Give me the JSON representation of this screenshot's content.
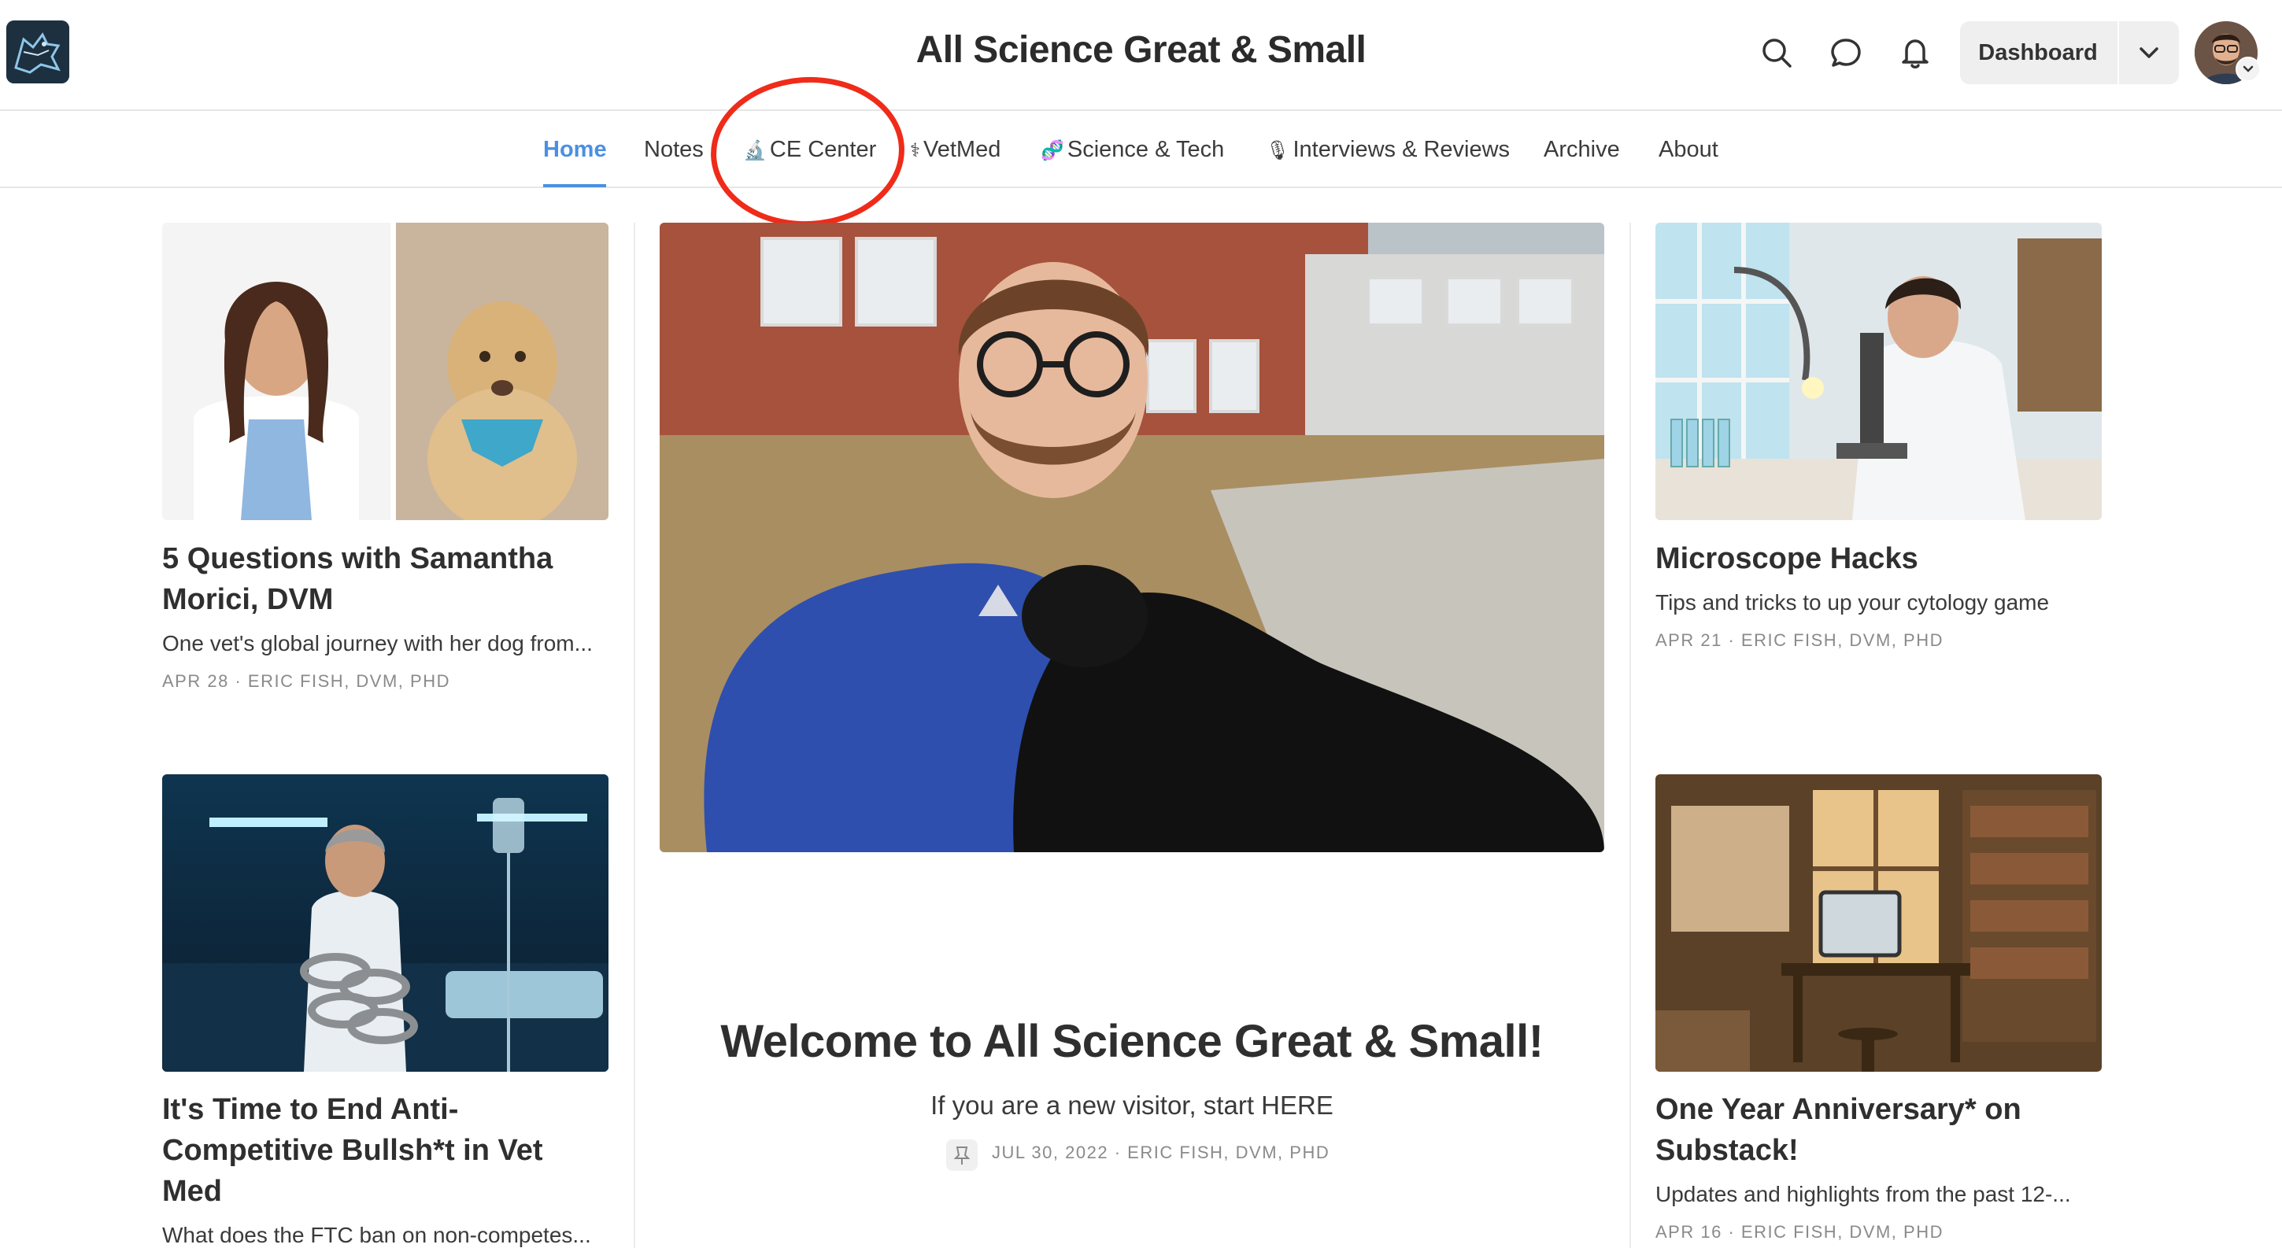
{
  "site": {
    "title": "All Science Great & Small"
  },
  "header": {
    "dashboard_label": "Dashboard"
  },
  "nav": [
    {
      "label": "Home",
      "icon": "",
      "active": true
    },
    {
      "label": "Notes",
      "icon": ""
    },
    {
      "label": "CE Center",
      "icon": "🔬"
    },
    {
      "label": "VetMed",
      "icon": "⚕"
    },
    {
      "label": "Science & Tech",
      "icon": "🧬"
    },
    {
      "label": "Interviews & Reviews",
      "icon": "🎙"
    },
    {
      "label": "Archive",
      "icon": ""
    },
    {
      "label": "About",
      "icon": ""
    }
  ],
  "annotation": {
    "color": "#ef2b1a"
  },
  "posts": [
    {
      "title": "5 Questions with Samantha Morici, DVM",
      "subtitle": "One vet's global journey with her dog from...",
      "date": "APR 28",
      "author": "ERIC FISH, DVM, PHD"
    },
    {
      "title": "It's Time to End Anti-Competitive Bullsh*t in Vet Med",
      "subtitle": "What does the FTC ban on non-competes...",
      "date": "",
      "author": ""
    },
    {
      "title": "Microscope Hacks",
      "subtitle": "Tips and tricks to up your cytology game",
      "date": "APR 21",
      "author": "ERIC FISH, DVM, PHD"
    },
    {
      "title": "One Year Anniversary* on Substack!",
      "subtitle": "Updates and highlights from the past 12-...",
      "date": "APR 16",
      "author": "ERIC FISH, DVM, PHD"
    }
  ],
  "featured": {
    "title": "Welcome to All Science Great & Small!",
    "subtitle": "If you are a new visitor, start HERE",
    "date": "JUL 30, 2022",
    "author": "ERIC FISH, DVM, PHD"
  },
  "meta_separator": "·",
  "colors": {
    "accent": "#4a90e2",
    "text": "#363737",
    "meta": "#8a8a8a"
  }
}
